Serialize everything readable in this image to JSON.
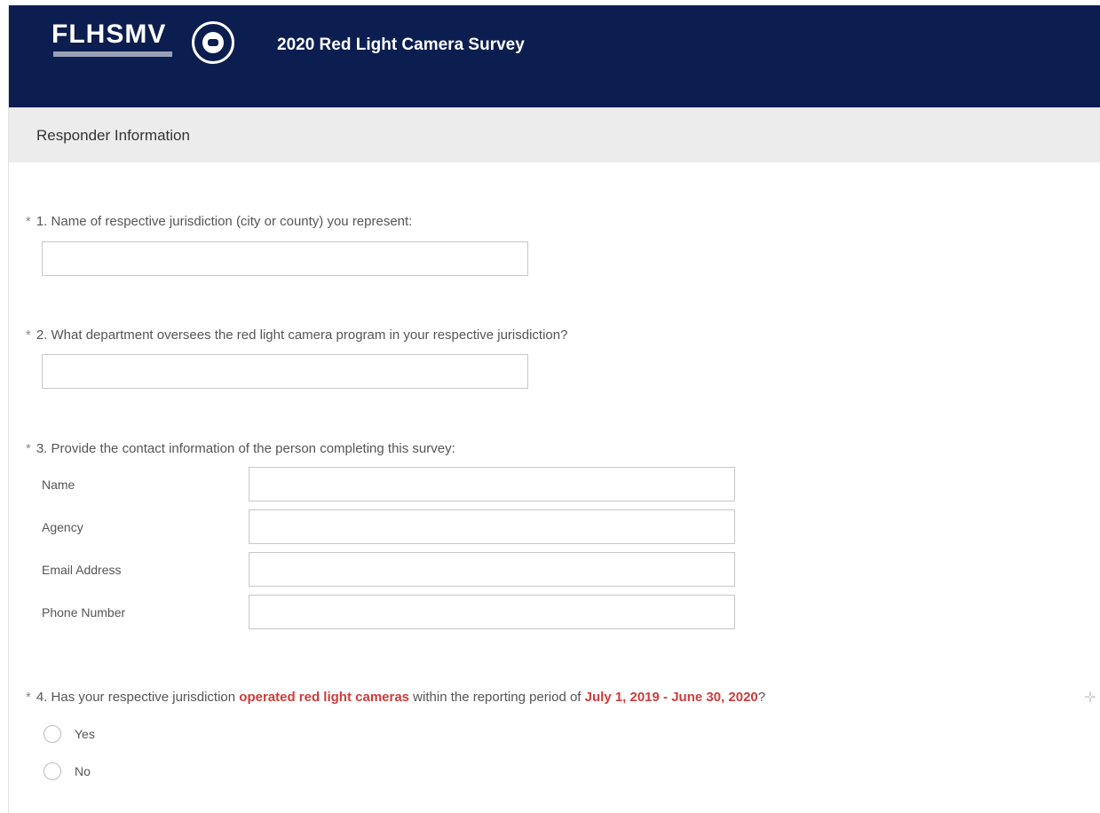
{
  "header": {
    "logo_text": "FLHSMV",
    "survey_title": "2020 Red Light Camera Survey",
    "seal_icon": "highway-patrol-seal-icon",
    "background_color": "#0c1e4f"
  },
  "section": {
    "title": "Responder Information"
  },
  "questions": [
    {
      "required_mark": "*",
      "text": "1. Name of respective jurisdiction (city or county) you represent:",
      "input_value": ""
    },
    {
      "required_mark": "*",
      "text": "2. What department oversees the red light camera program in your respective jurisdiction?",
      "input_value": ""
    },
    {
      "required_mark": "*",
      "text": "3. Provide the contact information of the person completing this survey:",
      "fields": [
        {
          "label": "Name",
          "value": ""
        },
        {
          "label": "Agency",
          "value": ""
        },
        {
          "label": "Email Address",
          "value": ""
        },
        {
          "label": "Phone Number",
          "value": ""
        }
      ]
    },
    {
      "required_mark": "*",
      "text_parts": [
        "4. Has your respective jurisdiction ",
        "operated red light cameras",
        " within the reporting period of ",
        "July 1, 2019 - June 30, 2020",
        "?"
      ],
      "highlight_color": "#d03b3b",
      "options": [
        "Yes",
        "No"
      ]
    }
  ]
}
